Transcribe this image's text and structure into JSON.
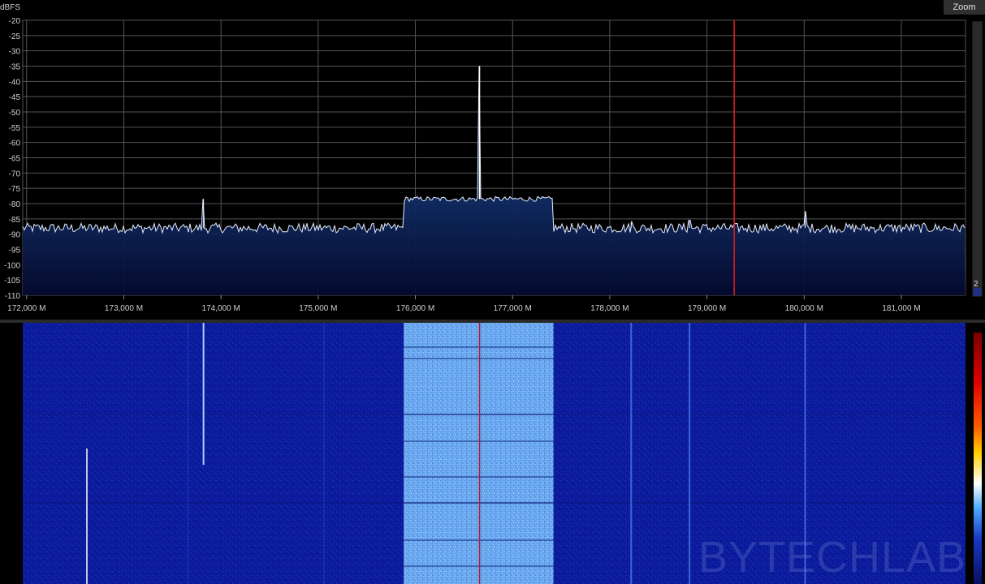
{
  "spectrum": {
    "unit_label": "dBFS",
    "zoom_button": "Zoom",
    "zoom_level": "2",
    "db_ticks": [
      "-20",
      "-25",
      "-30",
      "-35",
      "-40",
      "-45",
      "-50",
      "-55",
      "-60",
      "-65",
      "-70",
      "-75",
      "-80",
      "-85",
      "-90",
      "-95",
      "-100",
      "-105",
      "-110"
    ],
    "freq_ticks": [
      "172,000 M",
      "173,000 M",
      "174,000 M",
      "175,000 M",
      "176,000 M",
      "177,000 M",
      "178,000 M",
      "179,000 M",
      "180,000 M",
      "181,000 M"
    ],
    "db_range": [
      -110,
      -20
    ],
    "freq_range_mhz": [
      171.96,
      181.66
    ],
    "noise_floor_db": -88,
    "band": {
      "start_mhz": 175.88,
      "end_mhz": 177.42,
      "level_db": -78.5
    },
    "carrier": {
      "freq_mhz": 176.66,
      "peak_db": -35
    },
    "spurs": [
      {
        "freq_mhz": 173.82,
        "peak_db": -78.5
      },
      {
        "freq_mhz": 178.22,
        "peak_db": -86
      },
      {
        "freq_mhz": 178.82,
        "peak_db": -85.5
      },
      {
        "freq_mhz": 180.01,
        "peak_db": -82.5
      }
    ],
    "marker_freq_mhz": 179.28,
    "colors": {
      "trace": "#e8eeff",
      "fill_top": "#1e5aa8",
      "fill_bottom": "#050a30",
      "grid": "#555555",
      "marker": "#e02020"
    }
  },
  "waterfall": {
    "watermark": "BYTECHLAB",
    "colors": {
      "background": "#0a1a9a",
      "band": "#6aa8f0",
      "marker": "#b02030"
    }
  }
}
